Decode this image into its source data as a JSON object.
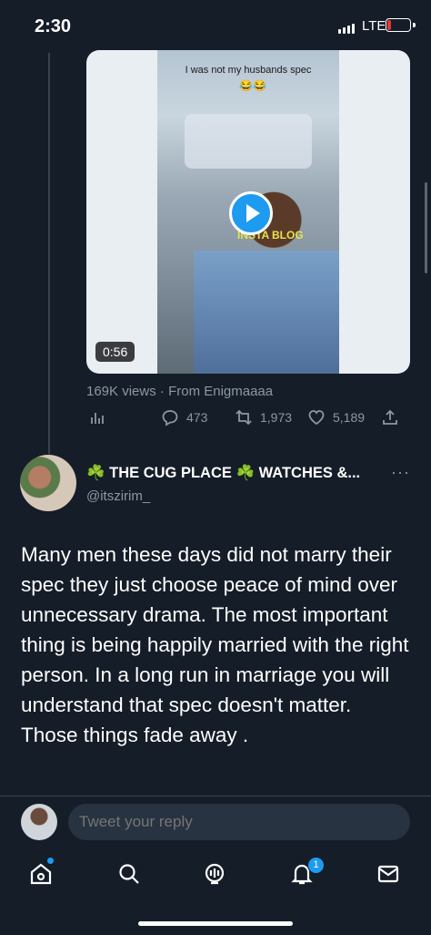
{
  "status_bar": {
    "time": "2:30",
    "network": "LTE"
  },
  "video": {
    "caption": "I was not my husbands spec",
    "emoji": "😂😂",
    "watermark": "INSTA BLOG",
    "duration": "0:56"
  },
  "video_meta": {
    "views": "169K views",
    "separator": " · ",
    "from": "From Enigmaaaa"
  },
  "actions": {
    "replies": "473",
    "retweets": "1,973",
    "likes": "5,189"
  },
  "reply_tweet": {
    "display_name": "☘️ THE CUG PLACE ☘️ WATCHES &...",
    "handle": "@itszirim_",
    "more": "···",
    "text": "Many men these days did not marry their spec they just choose peace of mind over unnecessary drama. The most important thing is being happily married with the right person. In a long run in marriage you will understand that spec doesn't matter. Those things fade away ."
  },
  "reply_box": {
    "placeholder": "Tweet your reply"
  },
  "nav": {
    "notifications_badge": "1"
  },
  "colors": {
    "background": "#151d28",
    "accent": "#1d9bf0",
    "muted": "#8b98a5"
  },
  "icons": [
    "analytics-icon",
    "reply-icon",
    "retweet-icon",
    "like-icon",
    "share-icon",
    "home-icon",
    "search-icon",
    "spaces-icon",
    "notifications-icon",
    "messages-icon"
  ]
}
